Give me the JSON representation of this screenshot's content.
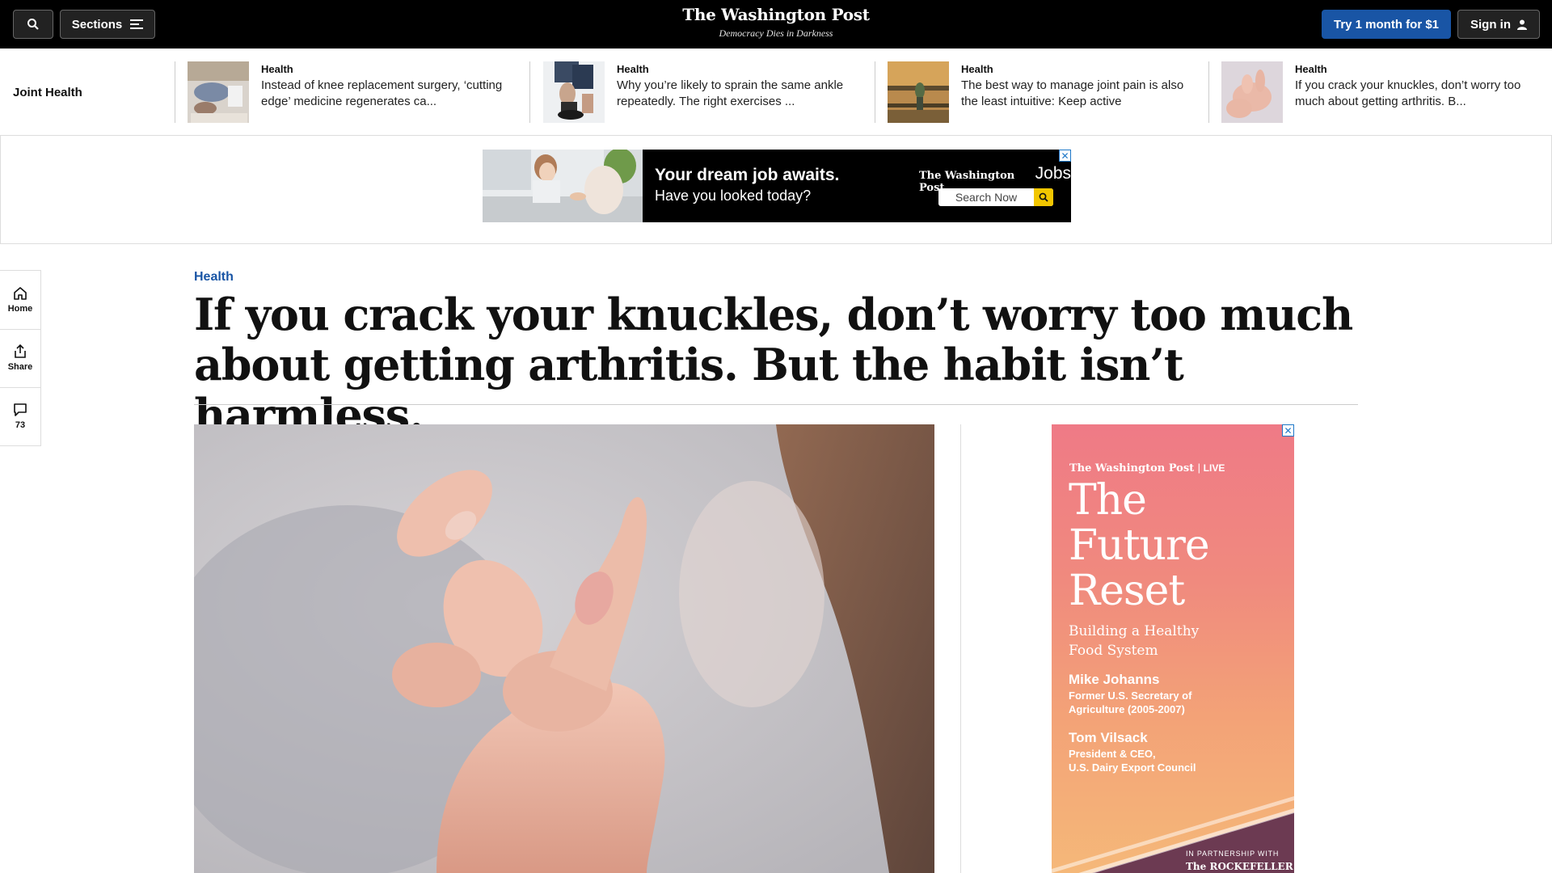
{
  "colors": {
    "topbar": "#000000",
    "accent": "#1955a5",
    "kicker": "#1955a5"
  },
  "topbar": {
    "search_icon": "search-icon",
    "sections_label": "Sections",
    "brand_name": "The Washington Post",
    "brand_tagline": "Democracy Dies in Darkness",
    "subscribe_label": "Try 1 month for $1",
    "signin_label": "Sign in"
  },
  "strip": {
    "title": "Joint Health",
    "cards": [
      {
        "kicker": "Health",
        "headline": "Instead of knee replacement surgery, ‘cutting edge’ medicine regenerates ca..."
      },
      {
        "kicker": "Health",
        "headline": "Why you’re likely to sprain the same ankle repeatedly. The right exercises ..."
      },
      {
        "kicker": "Health",
        "headline": "The best way to manage joint pain is also the least intuitive: Keep active"
      },
      {
        "kicker": "Health",
        "headline": "If you crack your knuckles, don’t worry too much about getting arthritis. B..."
      }
    ]
  },
  "banner_ad": {
    "headline": "Your dream job awaits.",
    "subline": "Have you looked today?",
    "brand": "The Washington Post",
    "brand_suffix": "Jobs",
    "search_label": "Search Now",
    "close": "✕"
  },
  "rail": {
    "home_label": "Home",
    "share_label": "Share",
    "comments_count": "73"
  },
  "article": {
    "kicker": "Health",
    "headline": "If you crack your knuckles, don’t worry too much about getting arthritis. But the habit isn’t harmless."
  },
  "side_ad": {
    "brand": "The Washington Post",
    "brand_suffix": "LIVE",
    "title_line1": "The",
    "title_line2": "Future",
    "title_line3": "Reset",
    "subtitle_line1": "Building a Healthy",
    "subtitle_line2": "Food System",
    "speakers": [
      {
        "name": "Mike Johanns",
        "role_line1": "Former U.S. Secretary of",
        "role_line2": "Agriculture (2005-2007)"
      },
      {
        "name": "Tom Vilsack",
        "role_line1": "President & CEO,",
        "role_line2": "U.S. Dairy Export Council"
      }
    ],
    "partnership": "IN PARTNERSHIP WITH",
    "partner": "The ROCKEFELLER",
    "close": "✕"
  }
}
